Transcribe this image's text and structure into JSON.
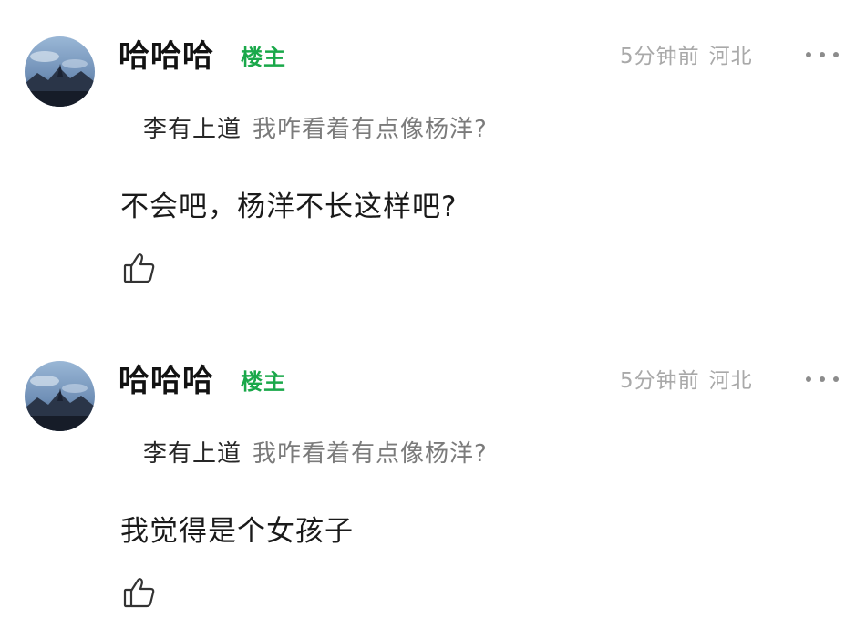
{
  "comments": [
    {
      "username": "哈哈哈",
      "badge": "楼主",
      "time": "5分钟前",
      "location": "河北",
      "quote_name": "李有上道",
      "quote_text": "我咋看着有点像杨洋?",
      "text": "不会吧，杨洋不长这样吧?"
    },
    {
      "username": "哈哈哈",
      "badge": "楼主",
      "time": "5分钟前",
      "location": "河北",
      "quote_name": "李有上道",
      "quote_text": "我咋看着有点像杨洋?",
      "text": "我觉得是个女孩子"
    }
  ],
  "icons": {
    "more": "more-dots-icon",
    "like": "thumbs-up-icon",
    "avatar": "avatar-image"
  },
  "colors": {
    "badge": "#1aa84a",
    "meta": "#a9a9a9",
    "quote_text": "#7b7b7b"
  }
}
